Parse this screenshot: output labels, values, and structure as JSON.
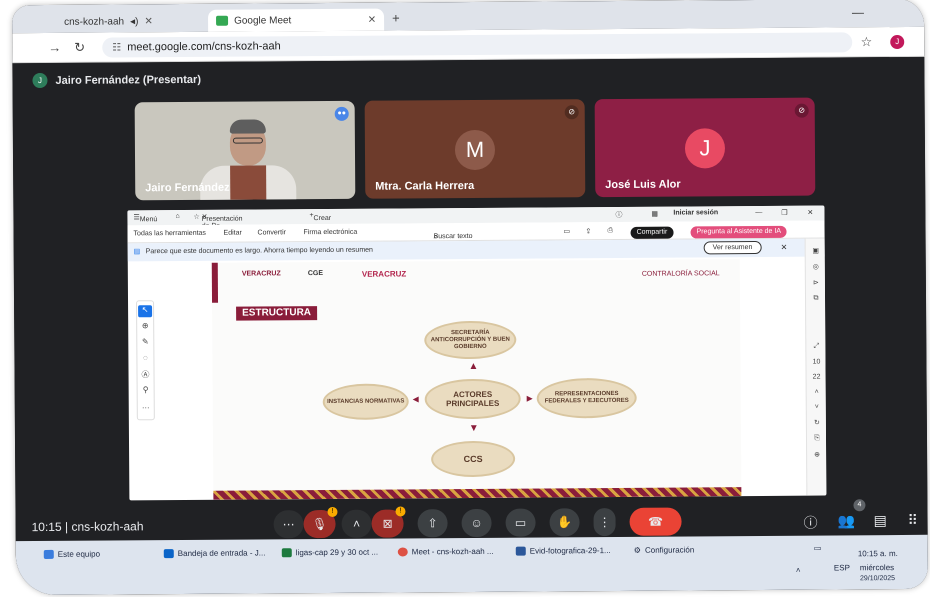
{
  "browser": {
    "tab1_title": "cns-kozh-aah",
    "tab2_title": "Google Meet",
    "url": "meet.google.com/cns-kozh-aah",
    "profile_initial": "J"
  },
  "meet": {
    "presenter_initial": "J",
    "presenter_label": "Jairo Fernández (Presentar)",
    "participants": [
      {
        "name": "Jairo Fernández",
        "initial": ""
      },
      {
        "name": "Mtra. Carla Herrera",
        "initial": "M"
      },
      {
        "name": "José Luis Alor",
        "initial": "J"
      }
    ],
    "time": "10:15",
    "separator": "|",
    "meeting_code": "cns-kozh-aah",
    "participant_count": "4",
    "warning_badge": "!"
  },
  "pdf_viewer": {
    "menu_label": "Menú",
    "tab_title": "Presentación de Po...",
    "new_tab": "Crear",
    "sign_in": "Iniciar sesión",
    "tools": [
      "Todas las herramientas",
      "Editar",
      "Convertir",
      "Firma electrónica"
    ],
    "search": "Buscar texto o herramientas",
    "share": "Compartir",
    "ai": "Pregunta al Asistente de IA",
    "notice": "Parece que este documento es largo. Ahorra tiempo leyendo un resumen",
    "summary_button": "Ver resumen",
    "page_current": "10",
    "page_total": "22"
  },
  "slide": {
    "logo_veracruz": "VERACRUZ",
    "logo_cge": "CGE",
    "logo_por": "VERACRUZ",
    "logo_contraloria": "CONTRALORÍA SOCIAL",
    "heading": "ESTRUCTURA",
    "node_top": "SECRETARÍA ANTICORRUPCIÓN Y BUEN GOBIERNO",
    "node_center": "ACTORES PRINCIPALES",
    "node_left": "INSTANCIAS NORMATIVAS",
    "node_right": "REPRESENTACIONES FEDERALES Y EJECUTORES",
    "node_bottom": "CCS"
  },
  "taskbar": {
    "items": [
      "Este equipo",
      "Bandeja de entrada - J...",
      "ligas-cap 29 y 30 oct ...",
      "Meet - cns-kozh-aah ...",
      "Evid-fotografica-29-1...",
      "Configuración"
    ],
    "lang": "ESP",
    "clock": "10:15 a. m.",
    "day": "miércoles",
    "date": "29/10/2025"
  },
  "colors": {
    "meet_bg": "#202124",
    "end_call": "#ea4335",
    "accent_maroon": "#8a1d3a"
  }
}
